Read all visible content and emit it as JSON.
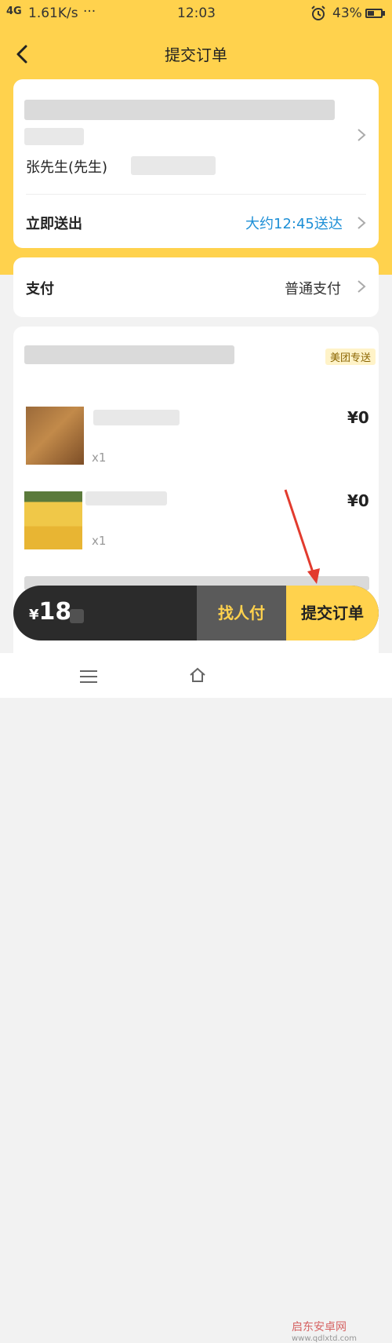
{
  "status_bar": {
    "network": "4G",
    "speed": "1.61K/s",
    "dots": "···",
    "time": "12:03",
    "alarm_icon": "alarm-clock-icon",
    "battery": "43%"
  },
  "nav": {
    "title": "提交订单",
    "back_icon": "chevron-left-icon"
  },
  "address": {
    "contact_name": "张先生(先生)"
  },
  "delivery": {
    "label": "立即送出",
    "eta": "大约12:45送达",
    "eta_color": "#1d8fd6"
  },
  "payment": {
    "label": "支付",
    "method": "普通支付"
  },
  "store": {
    "badge": "美团专送"
  },
  "items": [
    {
      "qty": "x1",
      "price": "¥0"
    },
    {
      "qty": "x1",
      "price": "¥0"
    }
  ],
  "bottom_bar": {
    "currency": "¥",
    "total": "18",
    "find_pay": "找人付",
    "submit": "提交订单",
    "accent_color": "#ffd24d"
  },
  "watermark": {
    "name": "启东安卓网",
    "url": "www.qdlxtd.com"
  }
}
